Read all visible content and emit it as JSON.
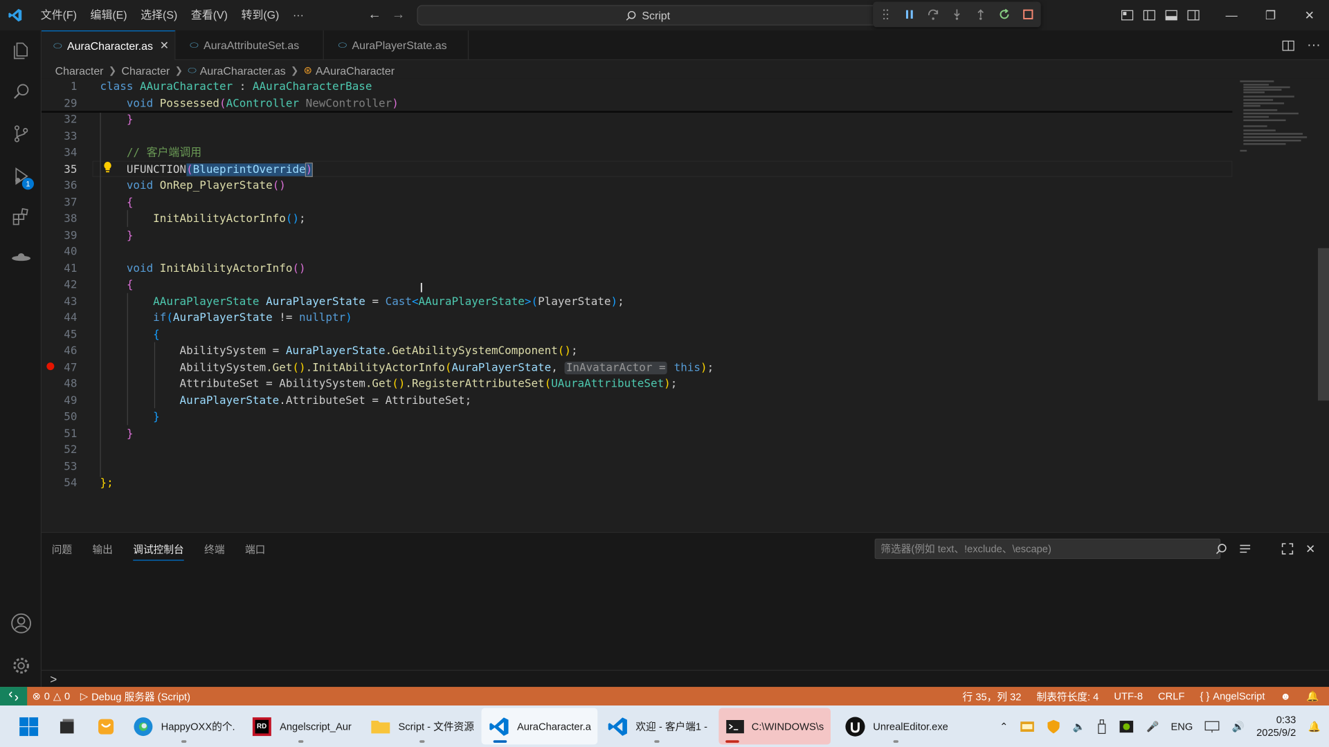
{
  "menu": [
    "文件(F)",
    "编辑(E)",
    "选择(S)",
    "查看(V)",
    "转到(G)",
    "···"
  ],
  "command_center": "Script",
  "tabs": [
    {
      "label": "AuraCharacter.as",
      "active": true
    },
    {
      "label": "AuraAttributeSet.as",
      "active": false
    },
    {
      "label": "AuraPlayerState.as",
      "active": false
    }
  ],
  "breadcrumb": [
    "Character",
    "Character",
    "AuraCharacter.as",
    "AAuraCharacter"
  ],
  "debug_badge": "1",
  "line_numbers": [
    "1",
    "29",
    "32",
    "33",
    "34",
    "35",
    "36",
    "37",
    "38",
    "39",
    "40",
    "41",
    "42",
    "43",
    "44",
    "45",
    "46",
    "47",
    "48",
    "49",
    "50",
    "51",
    "52",
    "53",
    "54"
  ],
  "code": {
    "l1_class": "class",
    "l1_name": "AAuraCharacter",
    "l1_colon": " : ",
    "l1_base": "AAuraCharacterBase",
    "l29_void": "void",
    "l29_fn": "Possessed",
    "l29_open": "(",
    "l29_type": "AController",
    "l29_param": "NewController",
    "l29_close": ")",
    "l32": "}",
    "l34": "// 客户端调用",
    "l35_macro": "UFUNCTION",
    "l35_open": "(",
    "l35_arg": "BlueprintOverride",
    "l35_close": ")",
    "l36_void": "void",
    "l36_fn": "OnRep_PlayerState",
    "l36_parens": "()",
    "l37": "{",
    "l38_fn": "InitAbilityActorInfo",
    "l38_parens": "()",
    "l38_semi": ";",
    "l39": "}",
    "l41_void": "void",
    "l41_fn": "InitAbilityActorInfo",
    "l41_parens": "()",
    "l42": "{",
    "l43_type": "AAuraPlayerState",
    "l43_var": "AuraPlayerState",
    "l43_eq": " = ",
    "l43_cast": "Cast",
    "l43_lt": "<",
    "l43_ttype": "AAuraPlayerState",
    "l43_gt": ">",
    "l43_open": "(",
    "l43_arg": "PlayerState",
    "l43_close": ")",
    "l43_semi": ";",
    "l44_if": "if",
    "l44_open": "(",
    "l44_var": "AuraPlayerState",
    "l44_ne": " != ",
    "l44_null": "nullptr",
    "l44_close": ")",
    "l45": "{",
    "l46_lhs": "AbilitySystem",
    "l46_eq": " = ",
    "l46_obj": "AuraPlayerState",
    "l46_fn": ".GetAbilitySystemComponent",
    "l46_parens": "()",
    "l46_semi": ";",
    "l47_obj": "AbilitySystem",
    "l47_get": ".Get",
    "l47_gp": "()",
    "l47_fn": ".InitAbilityActorInfo",
    "l47_open": "(",
    "l47_arg1": "AuraPlayerState",
    "l47_comma": ", ",
    "l47_hint": "InAvatarActor =",
    "l47_this": "this",
    "l47_close": ")",
    "l47_semi": ";",
    "l48_lhs": "AttributeSet",
    "l48_eq": " = ",
    "l48_obj": "AbilitySystem",
    "l48_get": ".Get",
    "l48_gp": "()",
    "l48_fn": ".RegisterAttributeSet",
    "l48_open": "(",
    "l48_arg": "UAuraAttributeSet",
    "l48_close": ")",
    "l48_semi": ";",
    "l49_obj": "AuraPlayerState",
    "l49_member": ".AttributeSet = AttributeSet;",
    "l50": "}",
    "l51": "}",
    "l54": "};"
  },
  "panel": {
    "tabs": [
      "问题",
      "输出",
      "调试控制台",
      "终端",
      "端口"
    ],
    "active_tab": "调试控制台",
    "filter_placeholder": "筛选器(例如 text、!exclude、\\escape)",
    "prompt": ">"
  },
  "statusbar": {
    "errors": "0",
    "warnings": "0",
    "debug": "Debug 服务器 (Script)",
    "position": "行 35，列 32",
    "tab_size": "制表符长度: 4",
    "encoding": "UTF-8",
    "eol": "CRLF",
    "language": "AngelScript"
  },
  "taskbar": {
    "apps": [
      {
        "label": "HappyOXX的个.",
        "icon": "edge-icon"
      },
      {
        "label": "Angelscript_Aur",
        "icon": "rider-icon"
      },
      {
        "label": "Script - 文件资源",
        "icon": "folder-icon"
      },
      {
        "label": "AuraCharacter.a",
        "icon": "vscode-icon"
      },
      {
        "label": "欢迎 - 客户端1 -",
        "icon": "vscode-icon"
      },
      {
        "label": "C:\\WINDOWS\\s",
        "icon": "terminal-icon"
      },
      {
        "label": "UnrealEditor.exe",
        "icon": "unreal-icon"
      }
    ],
    "lang": "ENG",
    "time": "0:33",
    "date": "2025/9/2"
  },
  "colors": {
    "statusbar": "#cc6633",
    "accent": "#0078d4",
    "editor_bg": "#1f1f1f"
  }
}
